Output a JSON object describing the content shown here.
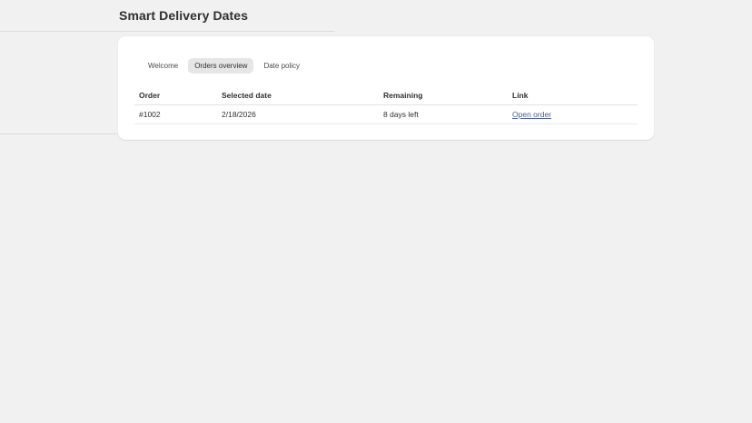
{
  "header": {
    "title": "Smart Delivery Dates"
  },
  "tabs": [
    {
      "label": "Welcome",
      "active": false
    },
    {
      "label": "Orders overview",
      "active": true
    },
    {
      "label": "Date policy",
      "active": false
    }
  ],
  "orders_table": {
    "columns": [
      "Order",
      "Selected date",
      "Remaining",
      "Link"
    ],
    "rows": [
      {
        "order": "#1002",
        "selected_date": "2/18/2026",
        "remaining": "8 days left",
        "link": "Open order"
      }
    ]
  },
  "colors": {
    "background": "#f1f1f1",
    "card": "#ffffff",
    "active_tab": "#e6e6e6",
    "link": "#4a5a9a"
  }
}
